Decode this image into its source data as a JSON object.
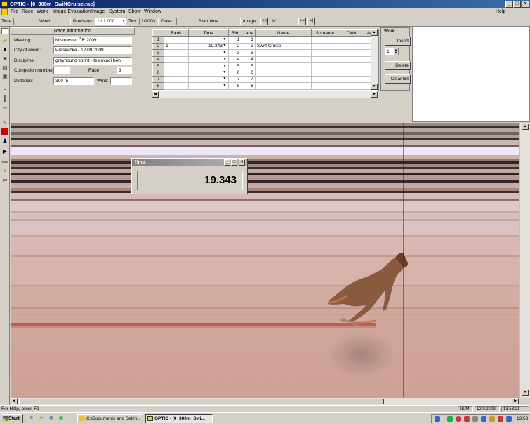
{
  "window": {
    "title": "OPTIC - [0_300m_SwiftCruise.rac]",
    "minimize": "_",
    "maximize": "□",
    "close": "×"
  },
  "menu": [
    "File",
    "Race",
    "Work",
    "Image Evaluation",
    "Image",
    "System",
    "Show",
    "Window"
  ],
  "menu_help": "Help",
  "toolbar": {
    "time_label": "Time:",
    "time_value": "",
    "wind_label": "Wind:",
    "wind_value": "",
    "precision_label": "Precision:",
    "precision_value": "1 / 1 000",
    "tick_label": "Tick:",
    "tick_value": "1/2000",
    "date_label": "Date:",
    "date_value": "",
    "start_time_label": "Start time",
    "start_time_value": "",
    "image_label": "Image:",
    "image_prev": "<<",
    "image_value": "1/1",
    "image_next": ">>",
    "image_last": ">|"
  },
  "race_info": {
    "header": "Race information",
    "meeting_label": "Meeting:",
    "meeting_value": "Mistrovství ČR 2009",
    "city_label": "City of event:",
    "city_value": "Praskačka - 12.09.2009",
    "discipline_label": "Discipline:",
    "discipline_value": "greyhound sprint - testovací běh",
    "competition_label": "Competion number:",
    "competition_value": "",
    "race_label": "Race",
    "race_value": "3",
    "distance_label": "Distance:",
    "distance_value": "300 m",
    "wind_label": "Wind:",
    "wind_value": ""
  },
  "results_table": {
    "columns": [
      "",
      "Rank",
      "Time",
      "Bib",
      "Lane",
      "Name",
      "Surname",
      "Club",
      "Age"
    ],
    "rows": [
      {
        "row": "1",
        "rank": "",
        "time": "",
        "bib": "1",
        "lane": "1",
        "name": "",
        "surname": "",
        "club": "",
        "age": ""
      },
      {
        "row": "2",
        "rank": "1",
        "time": "19.343",
        "bib": "2",
        "lane": "2",
        "name": "Swift Cruise",
        "surname": "",
        "club": "",
        "age": ""
      },
      {
        "row": "3",
        "rank": "",
        "time": "",
        "bib": "3",
        "lane": "3",
        "name": "",
        "surname": "",
        "club": "",
        "age": ""
      },
      {
        "row": "4",
        "rank": "",
        "time": "",
        "bib": "4",
        "lane": "4",
        "name": "",
        "surname": "",
        "club": "",
        "age": ""
      },
      {
        "row": "5",
        "rank": "",
        "time": "",
        "bib": "5",
        "lane": "5",
        "name": "",
        "surname": "",
        "club": "",
        "age": ""
      },
      {
        "row": "6",
        "rank": "",
        "time": "",
        "bib": "6",
        "lane": "6",
        "name": "",
        "surname": "",
        "club": "",
        "age": ""
      },
      {
        "row": "7",
        "rank": "",
        "time": "",
        "bib": "7",
        "lane": "7",
        "name": "",
        "surname": "",
        "club": "",
        "age": ""
      },
      {
        "row": "8",
        "rank": "",
        "time": "",
        "bib": "8",
        "lane": "8",
        "name": "",
        "surname": "",
        "club": "",
        "age": ""
      }
    ]
  },
  "work_panel": {
    "title": "Work",
    "insert_label": "Insert",
    "spinner_value": "1",
    "delete_label": "Delete",
    "clear_label": "Clear list"
  },
  "time_window": {
    "title": "Time:",
    "value": "19.343"
  },
  "status": {
    "help_text": "For Help, press F1",
    "num": "NUM",
    "date": "12.9.2009",
    "time": "13:53:21"
  },
  "taskbar": {
    "start_label": "Start",
    "items": [
      "C:\\Documents and Settin...",
      "OPTIC - [0_300m_Swi..."
    ],
    "clock": "13:53"
  },
  "colors": {
    "title_gradient_start": "#0a246a",
    "title_gradient_end": "#3a6ea5",
    "window_face": "#d4d0c8",
    "finish_line": "#2a2020"
  }
}
